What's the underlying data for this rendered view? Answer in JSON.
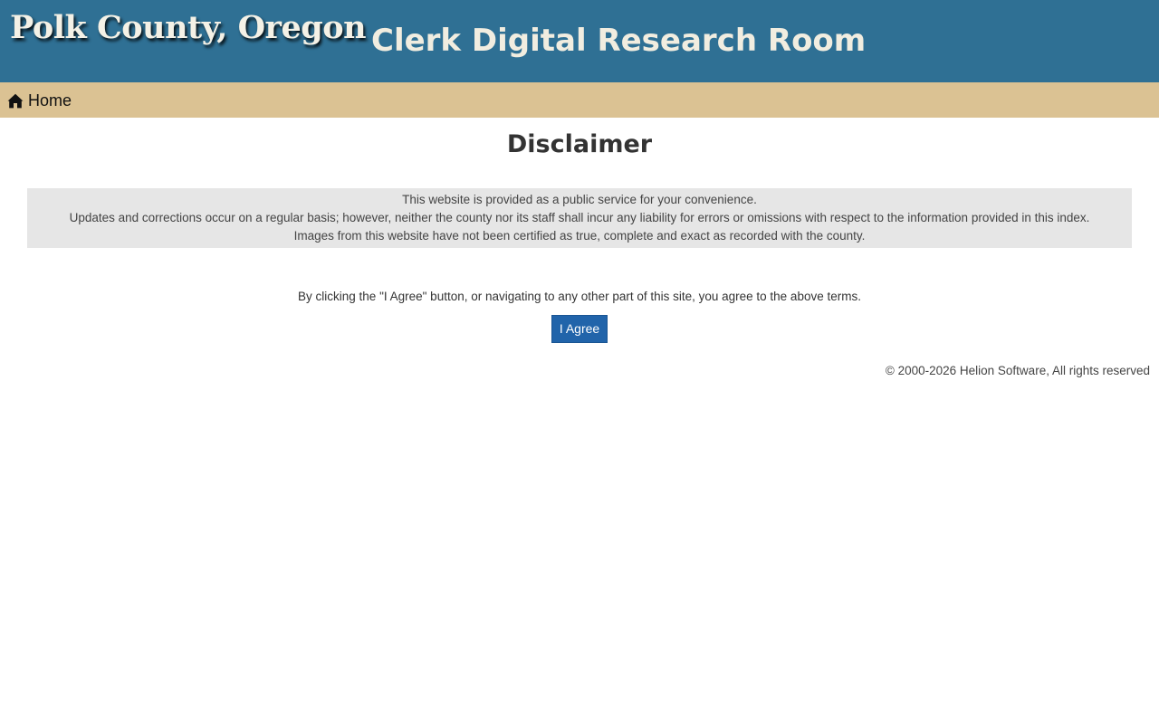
{
  "header": {
    "logo_text": "Polk County, Oregon",
    "site_title": "Clerk Digital Research Room",
    "background_color": "#2f7094"
  },
  "navbar": {
    "home_label": "Home",
    "home_icon": "home-icon",
    "background_color": "#dbc293"
  },
  "main": {
    "heading": "Disclaimer",
    "disclaimer_lines": [
      "This website is provided as a public service for your convenience.",
      "Updates and corrections occur on a regular basis; however, neither the county nor its staff shall incur any liability for errors or omissions with respect to the information provided in this index.",
      "Images from this website have not been certified as true, complete and exact as recorded with the county."
    ],
    "agree_text": "By clicking the \"I Agree\" button, or navigating to any other part of this site, you agree to the above terms.",
    "agree_button_label": "I Agree",
    "button_color": "#2164aa"
  },
  "footer": {
    "copyright": "© 2000-2026 Helion Software, All rights reserved"
  }
}
